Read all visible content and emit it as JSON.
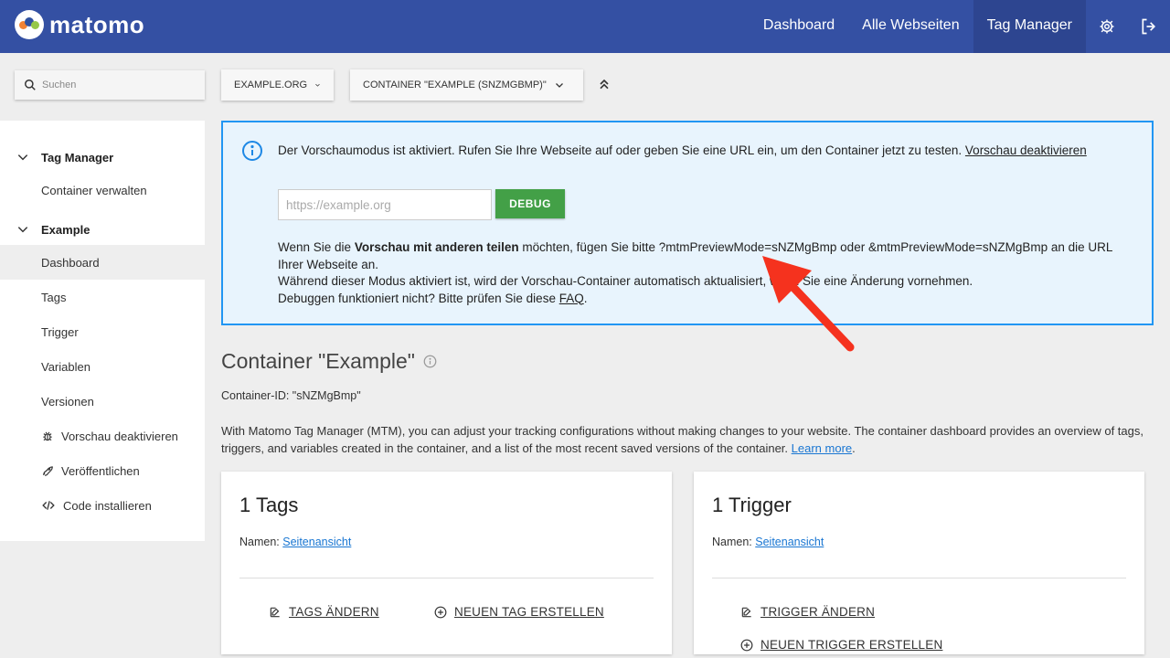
{
  "brand": {
    "name": "matomo"
  },
  "topnav": {
    "items": [
      {
        "label": "Dashboard"
      },
      {
        "label": "Alle Webseiten"
      },
      {
        "label": "Tag Manager"
      }
    ],
    "settings_icon": "gear-icon",
    "logout_icon": "logout-icon"
  },
  "search": {
    "placeholder": "Suchen"
  },
  "selectors": {
    "site": "EXAMPLE.ORG",
    "container": "CONTAINER \"EXAMPLE (SNZMGBMP)\""
  },
  "sidebar": {
    "group1": {
      "label": "Tag Manager",
      "items": [
        {
          "label": "Container verwalten"
        }
      ]
    },
    "group2": {
      "label": "Example",
      "items": [
        {
          "label": "Dashboard"
        },
        {
          "label": "Tags"
        },
        {
          "label": "Trigger"
        },
        {
          "label": "Variablen"
        },
        {
          "label": "Versionen"
        },
        {
          "label": "Vorschau deaktivieren",
          "icon": "bug-icon"
        },
        {
          "label": "Veröffentlichen",
          "icon": "rocket-icon"
        },
        {
          "label": "Code installieren",
          "icon": "code-icon"
        }
      ]
    }
  },
  "preview": {
    "message": "Der Vorschaumodus ist aktiviert. Rufen Sie Ihre Webseite auf oder geben Sie eine URL ein, um den Container jetzt zu testen.",
    "disable_link": "Vorschau deaktivieren",
    "url_placeholder": "https://example.org",
    "debug_label": "DEBUG",
    "share_prefix": "Wenn Sie die",
    "share_bold": "Vorschau mit anderen teilen",
    "share_suffix": "möchten, fügen Sie bitte ?mtmPreviewMode=sNZMgBmp oder &mtmPreviewMode=sNZMgBmp an die URL Ihrer Webseite an.",
    "auto_update": "Während dieser Modus aktiviert ist, wird der Vorschau-Container automatisch aktualisiert, wenn Sie eine Änderung vornehmen.",
    "debug_help": "Debuggen funktioniert nicht? Bitte prüfen Sie diese",
    "faq_link": "FAQ"
  },
  "container": {
    "title": "Container \"Example\"",
    "id_text": "Container-ID: \"sNZMgBmp\"",
    "description": "With Matomo Tag Manager (MTM), you can adjust your tracking configurations without making changes to your website. The container dashboard provides an overview of tags, triggers, and variables created in the container, and a list of the most recent saved versions of the container.",
    "learn_more": "Learn more"
  },
  "cards": {
    "tags": {
      "title": "1 Tags",
      "names_label": "Namen:",
      "names_link": "Seitenansicht",
      "edit_label": "TAGS ÄNDERN",
      "create_label": "NEUEN TAG ERSTELLEN"
    },
    "triggers": {
      "title": "1 Trigger",
      "names_label": "Namen:",
      "names_link": "Seitenansicht",
      "edit_label": "TRIGGER ÄNDERN",
      "create_label": "NEUEN TRIGGER ERSTELLEN"
    }
  },
  "colors": {
    "header": "#3450a3",
    "notice_border": "#2196f3",
    "debug_button": "#43a047",
    "annotation_arrow": "#f5321e"
  }
}
